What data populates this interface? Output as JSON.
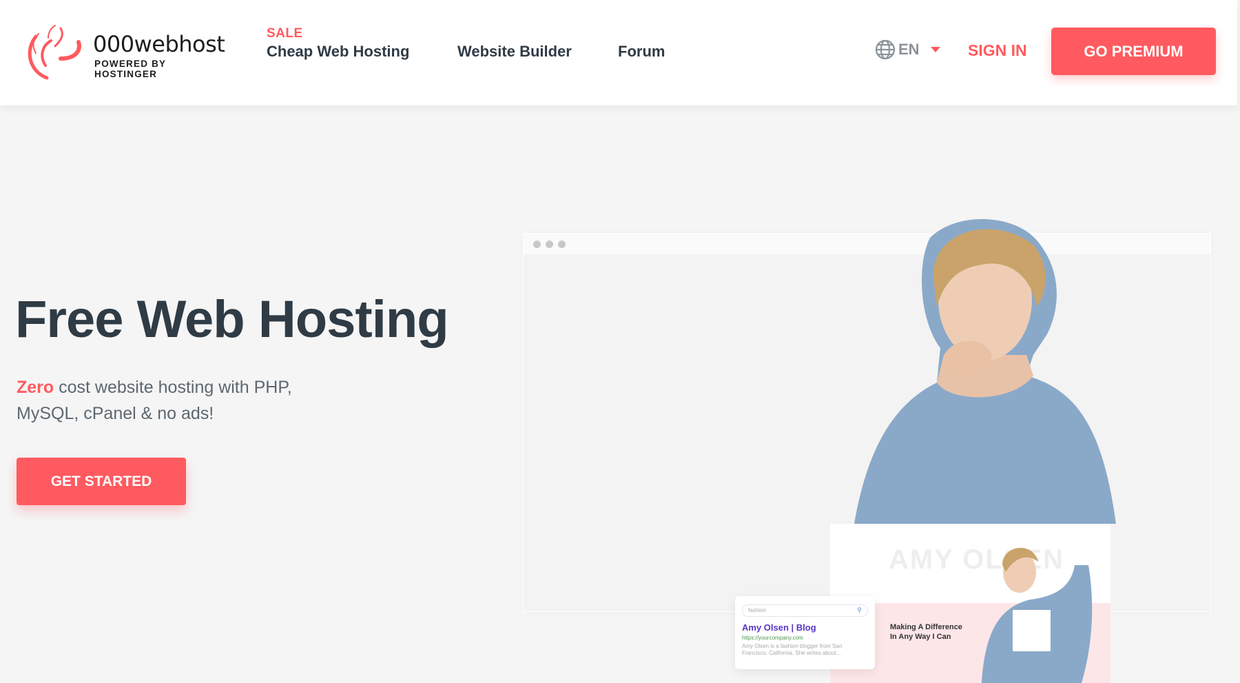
{
  "header": {
    "logo": {
      "name": "000webhost",
      "tagline": "POWERED BY HOSTINGER"
    },
    "nav": {
      "sale_badge": "SALE",
      "items": [
        "Cheap Web Hosting",
        "Website Builder",
        "Forum"
      ]
    },
    "language": {
      "icon": "globe-icon",
      "value": "EN"
    },
    "sign_in": "SIGN IN",
    "go_premium": "GO PREMIUM"
  },
  "hero": {
    "title": "Free Web Hosting",
    "subtitle_highlight": "Zero",
    "subtitle_rest": " cost website hosting with PHP, MySQL, cPanel & no ads!",
    "cta": "GET STARTED"
  },
  "mockup": {
    "site_watermark": "AMY OLSEN",
    "site_headline": "Making A Difference In Any Way I Can",
    "search_query": "fashion",
    "result_title": "Amy Olsen | Blog",
    "result_url": "https://yourcompany.com",
    "result_desc": "Amy Olsen is a fashion blogger from San Francisco, California. She writes about..."
  },
  "colors": {
    "accent": "#ff5a5f",
    "text": "#2f3b45",
    "background": "#f5f5f5"
  }
}
